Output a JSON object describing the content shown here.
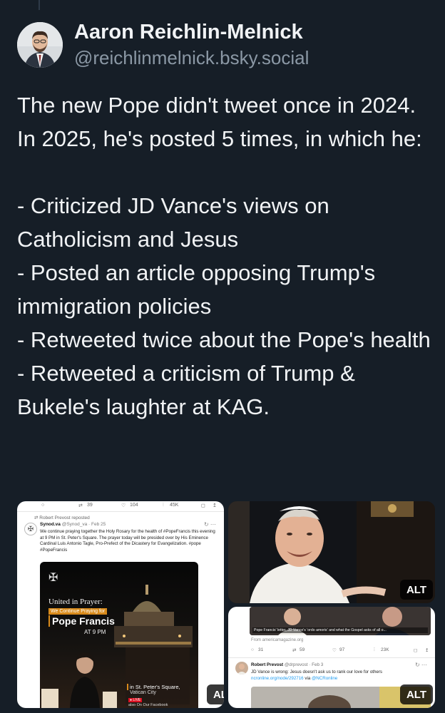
{
  "author": {
    "display_name": "Aaron Reichlin-Melnick",
    "handle": "@reichlinmelnick.bsky.social"
  },
  "post": {
    "text": "The new Pope didn't tweet once in 2024. In 2025, he's posted 5 times, in which he:\n\n- Criticized JD Vance's views on Catholicism and Jesus\n- Posted an article opposing Trump's immigration policies\n- Retweeted twice about the Pope's health\n- Retweeted a criticism of Trump & Bukele's laughter at KAG."
  },
  "media": {
    "left": {
      "stats": [
        "39",
        "104",
        "45K"
      ],
      "repost_label": "Robert Prevost reposted",
      "author_name": "Synod.va",
      "author_handle": "@Synod_va · Feb 25",
      "tweet_text": "We continue praying together the Holy Rosary for the health of #PopeFrancis this evening at 9 PM in St. Peter's Square. The prayer today will be presided over by His Eminence Cardinal Luis Antonio Tagle, Pro-Prefect of the Dicastery for Evangelization. #pope #PopeFrancis",
      "poster_united": "United in Prayer:",
      "poster_continue": "We Continue Praying for",
      "poster_name": "Pope Francis",
      "poster_time": "AT 9 PM",
      "poster_place_line1": "in St. Peter's Square,",
      "poster_place_line2": "Vatican City",
      "poster_live": "● LIVE",
      "poster_facebook": "also On Our Facebook",
      "alt": "ALT"
    },
    "right_top": {
      "alt": "ALT"
    },
    "right_bottom": {
      "link_title": "Pope Francis' letter, JD Vance's 'ordo amoris' and what the Gospel asks of all o...",
      "link_source": "From americamagazine.org",
      "stats": [
        "31",
        "59",
        "97",
        "23K"
      ],
      "author_name": "Robert Prevost",
      "author_handle": "@drprevost · Feb 3",
      "tweet_line1": "JD Vance is wrong: Jesus doesn't ask us to rank our love for others",
      "tweet_link": "ncronline.org/node/292716",
      "tweet_via": "via",
      "tweet_mention": "@NCRonline",
      "alt": "ALT"
    }
  },
  "colors": {
    "background": "#161e27",
    "text": "#f1f3f5",
    "muted": "#8b98a5",
    "link": "#1d9bf0"
  }
}
